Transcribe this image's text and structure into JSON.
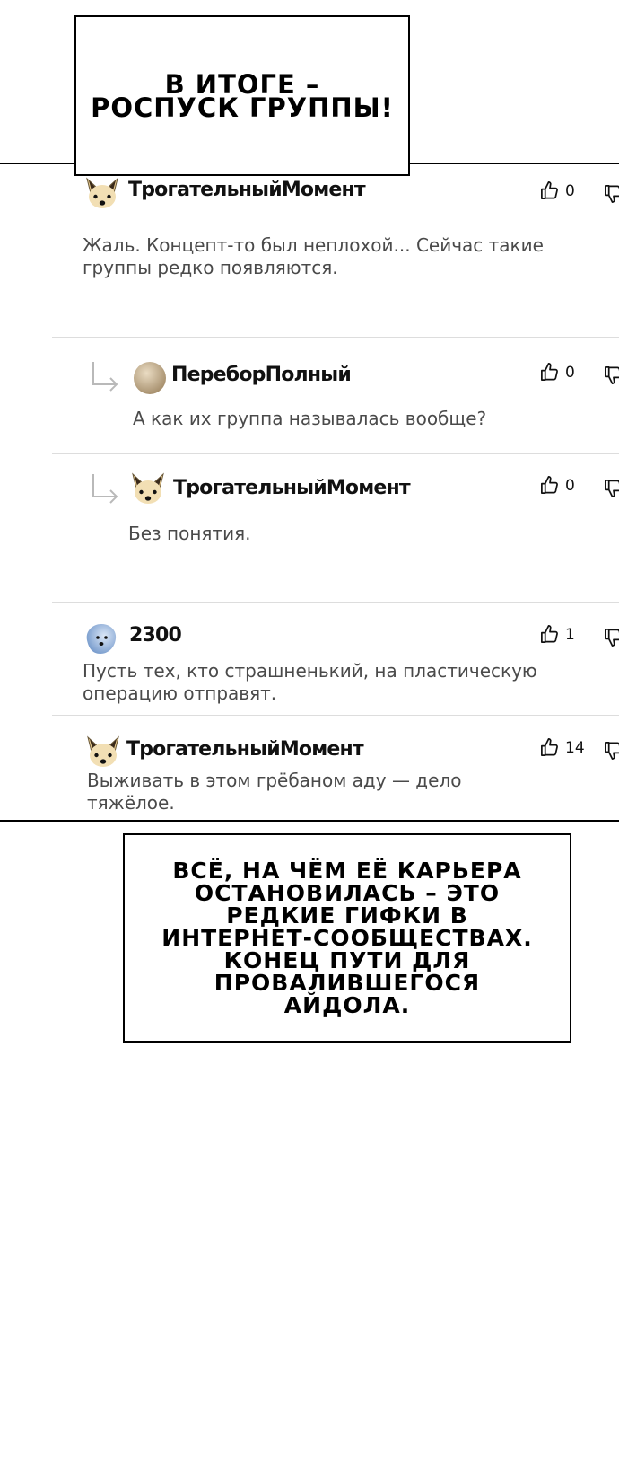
{
  "captions": {
    "top": "В итоге – роспуск группы!",
    "bottom": "Всё, на чём её карьера остановилась – это редкие гифки в интернет-сообществах. Конец пути для провалившегося айдола."
  },
  "comments": [
    {
      "author": "ТрогательныйМомент",
      "avatar": "fox-avatar-icon",
      "text": "Жаль. Концепт-то был неплохой... Сейчас такие группы редко появляются.",
      "likes": "0",
      "reply": false
    },
    {
      "author": "ПереборПолный",
      "avatar": "round-avatar-icon",
      "text": "А как их группа называлась вообще?",
      "likes": "0",
      "reply": true
    },
    {
      "author": "ТрогательныйМомент",
      "avatar": "fox-avatar-icon",
      "text": "Без понятия.",
      "likes": "0",
      "reply": true
    },
    {
      "author": "2300",
      "avatar": "blue-avatar-icon",
      "text": "Пусть тех, кто страшненький, на пластическую операцию отправят.",
      "likes": "1",
      "reply": false
    },
    {
      "author": "ТрогательныйМомент",
      "avatar": "fox-avatar-icon",
      "text": "Выживать в этом грёбаном аду — дело тяжёлое.",
      "likes": "14",
      "reply": false
    }
  ]
}
